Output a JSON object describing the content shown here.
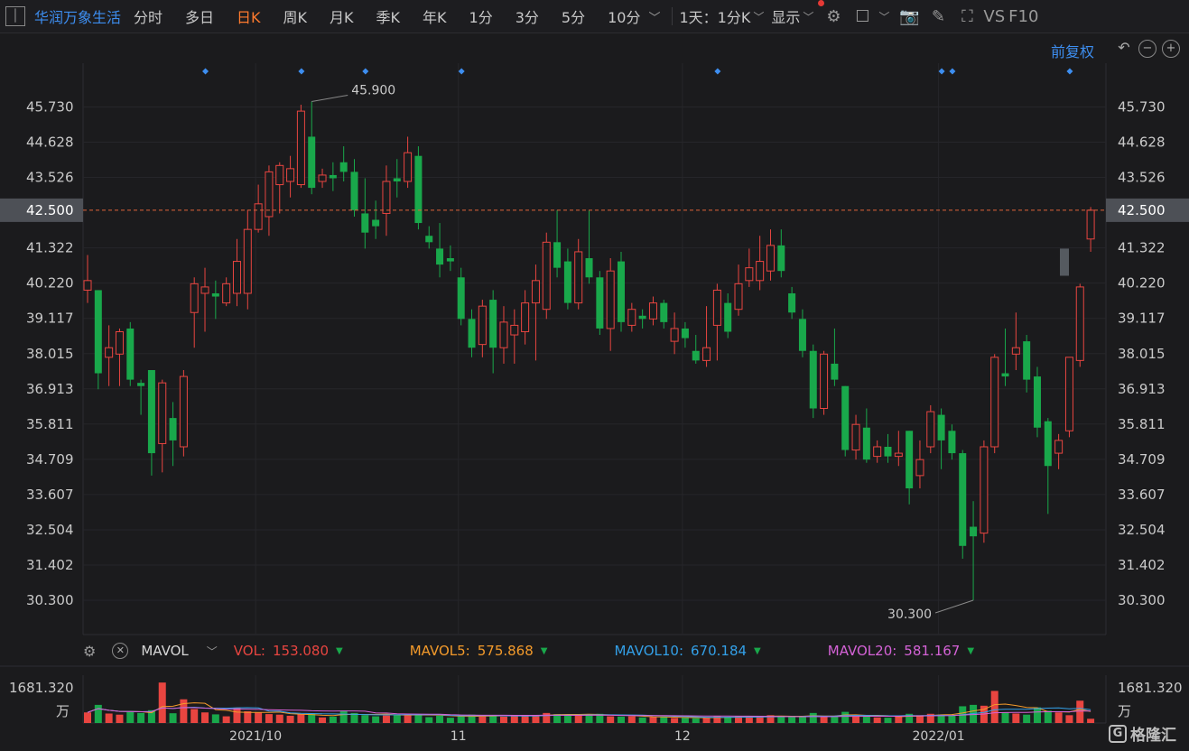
{
  "toolbar": {
    "stock_name": "华润万象生活",
    "periods": [
      "分时",
      "多日",
      "日K",
      "周K",
      "月K",
      "季K",
      "年K",
      "1分",
      "3分",
      "5分",
      "10分"
    ],
    "active_period": "日K",
    "multi_period": "1天：1分K",
    "display": "显示",
    "vs": "VS",
    "f10": "F10"
  },
  "adjust": {
    "label": "前复权"
  },
  "colors": {
    "up": "#e84540",
    "down": "#19a84b",
    "accent": "#3d8ef0",
    "active": "#ff7a2e",
    "mavol5": "#f39a2b",
    "mavol10": "#33a0e8",
    "mavol20": "#d462d6",
    "current_line": "#e0643a"
  },
  "price_axis": {
    "ticks": [
      "45.730",
      "44.628",
      "43.526",
      "41.322",
      "40.220",
      "39.117",
      "38.015",
      "36.913",
      "35.811",
      "34.709",
      "33.607",
      "32.504",
      "31.402",
      "30.300"
    ],
    "current": "42.500"
  },
  "annotations": {
    "high": "45.900",
    "low": "30.300"
  },
  "date_axis": [
    "2021/10",
    "11",
    "12",
    "2022/01"
  ],
  "volume_legend": {
    "indicator": "MAVOL",
    "vol_label": "VOL:",
    "vol_value": "153.080",
    "mavol5_label": "MAVOL5:",
    "mavol5_value": "575.868",
    "mavol10_label": "MAVOL10:",
    "mavol10_value": "670.184",
    "mavol20_label": "MAVOL20:",
    "mavol20_value": "581.167"
  },
  "volume_axis": {
    "max": "1681.320",
    "unit": "万"
  },
  "logo_text": "格隆汇",
  "chart_data": {
    "type": "candlestick",
    "ylim": [
      29.8,
      46.3
    ],
    "current_price": 42.5,
    "candles": [
      {
        "o": 40.0,
        "c": 40.3,
        "h": 41.1,
        "l": 39.6,
        "v": 380
      },
      {
        "o": 40.0,
        "c": 37.4,
        "h": 40.0,
        "l": 36.9,
        "v": 650
      },
      {
        "o": 37.9,
        "c": 38.2,
        "h": 38.9,
        "l": 37.0,
        "v": 340
      },
      {
        "o": 38.0,
        "c": 38.7,
        "h": 38.8,
        "l": 37.0,
        "v": 300
      },
      {
        "o": 38.8,
        "c": 37.2,
        "h": 39.0,
        "l": 37.0,
        "v": 390
      },
      {
        "o": 37.1,
        "c": 37.0,
        "h": 37.2,
        "l": 36.1,
        "v": 360
      },
      {
        "o": 37.5,
        "c": 34.9,
        "h": 37.5,
        "l": 34.2,
        "v": 460
      },
      {
        "o": 35.2,
        "c": 37.1,
        "h": 37.2,
        "l": 34.3,
        "v": 1450
      },
      {
        "o": 36.0,
        "c": 35.3,
        "h": 36.5,
        "l": 34.5,
        "v": 350
      },
      {
        "o": 35.1,
        "c": 37.3,
        "h": 37.5,
        "l": 34.8,
        "v": 850
      },
      {
        "o": 39.3,
        "c": 40.2,
        "h": 40.4,
        "l": 38.2,
        "v": 500
      },
      {
        "o": 39.9,
        "c": 40.1,
        "h": 40.7,
        "l": 38.7,
        "v": 380
      },
      {
        "o": 39.9,
        "c": 39.8,
        "h": 40.3,
        "l": 39.1,
        "v": 310
      },
      {
        "o": 39.6,
        "c": 40.2,
        "h": 40.4,
        "l": 39.5,
        "v": 240
      },
      {
        "o": 39.9,
        "c": 40.9,
        "h": 41.6,
        "l": 39.5,
        "v": 540
      },
      {
        "o": 39.9,
        "c": 41.9,
        "h": 42.5,
        "l": 39.4,
        "v": 420
      },
      {
        "o": 41.9,
        "c": 42.7,
        "h": 43.3,
        "l": 41.8,
        "v": 380
      },
      {
        "o": 42.3,
        "c": 43.7,
        "h": 43.9,
        "l": 41.7,
        "v": 320
      },
      {
        "o": 43.3,
        "c": 43.9,
        "h": 44.0,
        "l": 42.4,
        "v": 300
      },
      {
        "o": 43.4,
        "c": 43.8,
        "h": 44.2,
        "l": 42.9,
        "v": 260
      },
      {
        "o": 43.3,
        "c": 45.6,
        "h": 45.8,
        "l": 43.2,
        "v": 310
      },
      {
        "o": 44.8,
        "c": 43.2,
        "h": 45.9,
        "l": 43.0,
        "v": 330
      },
      {
        "o": 43.4,
        "c": 43.6,
        "h": 43.8,
        "l": 43.2,
        "v": 200
      },
      {
        "o": 43.6,
        "c": 43.5,
        "h": 44.0,
        "l": 43.1,
        "v": 230
      },
      {
        "o": 44.0,
        "c": 43.7,
        "h": 44.5,
        "l": 43.4,
        "v": 440
      },
      {
        "o": 43.7,
        "c": 42.5,
        "h": 44.1,
        "l": 42.3,
        "v": 360
      },
      {
        "o": 42.4,
        "c": 41.8,
        "h": 43.5,
        "l": 41.3,
        "v": 280
      },
      {
        "o": 42.2,
        "c": 42.0,
        "h": 42.8,
        "l": 41.6,
        "v": 240
      },
      {
        "o": 42.4,
        "c": 43.4,
        "h": 43.9,
        "l": 41.7,
        "v": 270
      },
      {
        "o": 43.5,
        "c": 43.4,
        "h": 44.1,
        "l": 42.9,
        "v": 300
      },
      {
        "o": 43.4,
        "c": 44.3,
        "h": 44.8,
        "l": 43.2,
        "v": 330
      },
      {
        "o": 44.2,
        "c": 42.1,
        "h": 44.5,
        "l": 41.9,
        "v": 320
      },
      {
        "o": 41.7,
        "c": 41.5,
        "h": 42.0,
        "l": 41.3,
        "v": 210
      },
      {
        "o": 41.3,
        "c": 40.8,
        "h": 42.1,
        "l": 40.4,
        "v": 260
      },
      {
        "o": 41.0,
        "c": 40.9,
        "h": 41.4,
        "l": 40.6,
        "v": 190
      },
      {
        "o": 40.4,
        "c": 39.1,
        "h": 40.7,
        "l": 38.9,
        "v": 240
      },
      {
        "o": 39.1,
        "c": 38.2,
        "h": 39.4,
        "l": 37.9,
        "v": 300
      },
      {
        "o": 38.3,
        "c": 39.5,
        "h": 39.7,
        "l": 37.9,
        "v": 240
      },
      {
        "o": 39.7,
        "c": 38.2,
        "h": 40.0,
        "l": 37.4,
        "v": 280
      },
      {
        "o": 38.2,
        "c": 39.0,
        "h": 39.5,
        "l": 37.7,
        "v": 230
      },
      {
        "o": 38.6,
        "c": 38.9,
        "h": 39.4,
        "l": 37.7,
        "v": 260
      },
      {
        "o": 38.7,
        "c": 39.6,
        "h": 40.0,
        "l": 38.3,
        "v": 280
      },
      {
        "o": 39.6,
        "c": 40.3,
        "h": 40.8,
        "l": 37.8,
        "v": 270
      },
      {
        "o": 39.4,
        "c": 41.5,
        "h": 41.8,
        "l": 39.1,
        "v": 360
      },
      {
        "o": 41.5,
        "c": 40.7,
        "h": 42.5,
        "l": 40.4,
        "v": 320
      },
      {
        "o": 40.9,
        "c": 39.6,
        "h": 41.3,
        "l": 39.4,
        "v": 300
      },
      {
        "o": 39.6,
        "c": 41.2,
        "h": 41.6,
        "l": 39.4,
        "v": 290
      },
      {
        "o": 41.0,
        "c": 40.4,
        "h": 42.5,
        "l": 40.2,
        "v": 300
      },
      {
        "o": 40.4,
        "c": 38.8,
        "h": 40.6,
        "l": 38.6,
        "v": 330
      },
      {
        "o": 38.8,
        "c": 40.6,
        "h": 41.0,
        "l": 38.1,
        "v": 240
      },
      {
        "o": 40.9,
        "c": 39.0,
        "h": 41.2,
        "l": 38.7,
        "v": 230
      },
      {
        "o": 38.9,
        "c": 39.4,
        "h": 39.6,
        "l": 38.7,
        "v": 240
      },
      {
        "o": 39.2,
        "c": 39.1,
        "h": 39.4,
        "l": 38.8,
        "v": 200
      },
      {
        "o": 39.1,
        "c": 39.6,
        "h": 39.8,
        "l": 38.9,
        "v": 210
      },
      {
        "o": 39.6,
        "c": 39.0,
        "h": 39.7,
        "l": 38.8,
        "v": 220
      },
      {
        "o": 38.4,
        "c": 38.8,
        "h": 39.3,
        "l": 38.0,
        "v": 180
      },
      {
        "o": 38.8,
        "c": 38.5,
        "h": 39.0,
        "l": 38.2,
        "v": 190
      },
      {
        "o": 38.1,
        "c": 37.8,
        "h": 38.6,
        "l": 37.7,
        "v": 170
      },
      {
        "o": 37.8,
        "c": 38.2,
        "h": 39.5,
        "l": 37.6,
        "v": 190
      },
      {
        "o": 38.9,
        "c": 40.0,
        "h": 40.2,
        "l": 37.8,
        "v": 250
      },
      {
        "o": 39.6,
        "c": 38.7,
        "h": 39.9,
        "l": 38.5,
        "v": 220
      },
      {
        "o": 39.4,
        "c": 40.2,
        "h": 40.8,
        "l": 39.2,
        "v": 240
      },
      {
        "o": 40.3,
        "c": 40.7,
        "h": 41.3,
        "l": 40.1,
        "v": 230
      },
      {
        "o": 40.3,
        "c": 40.9,
        "h": 41.7,
        "l": 40.0,
        "v": 260
      },
      {
        "o": 40.6,
        "c": 41.4,
        "h": 41.9,
        "l": 40.3,
        "v": 280
      },
      {
        "o": 41.4,
        "c": 40.6,
        "h": 41.9,
        "l": 40.4,
        "v": 240
      },
      {
        "o": 39.9,
        "c": 39.3,
        "h": 40.1,
        "l": 39.1,
        "v": 210
      },
      {
        "o": 39.1,
        "c": 38.1,
        "h": 39.4,
        "l": 37.9,
        "v": 230
      },
      {
        "o": 38.1,
        "c": 36.3,
        "h": 38.3,
        "l": 36.0,
        "v": 360
      },
      {
        "o": 36.3,
        "c": 38.0,
        "h": 38.1,
        "l": 36.1,
        "v": 210
      },
      {
        "o": 37.7,
        "c": 37.2,
        "h": 38.8,
        "l": 37.0,
        "v": 250
      },
      {
        "o": 37.0,
        "c": 35.0,
        "h": 37.0,
        "l": 34.8,
        "v": 400
      },
      {
        "o": 35.0,
        "c": 35.8,
        "h": 36.1,
        "l": 34.7,
        "v": 250
      },
      {
        "o": 35.7,
        "c": 34.7,
        "h": 36.3,
        "l": 34.6,
        "v": 270
      },
      {
        "o": 34.8,
        "c": 35.1,
        "h": 35.3,
        "l": 34.6,
        "v": 200
      },
      {
        "o": 35.1,
        "c": 34.8,
        "h": 35.5,
        "l": 34.6,
        "v": 190
      },
      {
        "o": 34.8,
        "c": 34.9,
        "h": 35.6,
        "l": 34.5,
        "v": 230
      },
      {
        "o": 35.6,
        "c": 33.8,
        "h": 35.6,
        "l": 33.3,
        "v": 330
      },
      {
        "o": 34.2,
        "c": 34.7,
        "h": 35.3,
        "l": 33.8,
        "v": 280
      },
      {
        "o": 35.1,
        "c": 36.2,
        "h": 36.4,
        "l": 34.9,
        "v": 330
      },
      {
        "o": 36.1,
        "c": 35.3,
        "h": 36.3,
        "l": 34.4,
        "v": 300
      },
      {
        "o": 35.6,
        "c": 34.9,
        "h": 35.8,
        "l": 34.7,
        "v": 280
      },
      {
        "o": 34.9,
        "c": 32.0,
        "h": 35.0,
        "l": 31.6,
        "v": 600
      },
      {
        "o": 32.6,
        "c": 32.3,
        "h": 33.4,
        "l": 30.3,
        "v": 650
      },
      {
        "o": 32.4,
        "c": 35.1,
        "h": 35.3,
        "l": 32.1,
        "v": 620
      },
      {
        "o": 35.1,
        "c": 37.9,
        "h": 38.0,
        "l": 34.9,
        "v": 1150
      },
      {
        "o": 37.4,
        "c": 37.3,
        "h": 38.8,
        "l": 37.0,
        "v": 380
      },
      {
        "o": 38.0,
        "c": 38.2,
        "h": 39.3,
        "l": 37.5,
        "v": 340
      },
      {
        "o": 38.4,
        "c": 37.2,
        "h": 38.6,
        "l": 36.8,
        "v": 300
      },
      {
        "o": 37.3,
        "c": 35.7,
        "h": 37.6,
        "l": 35.4,
        "v": 560
      },
      {
        "o": 35.9,
        "c": 34.5,
        "h": 36.0,
        "l": 33.0,
        "v": 440
      },
      {
        "o": 34.9,
        "c": 35.3,
        "h": 35.5,
        "l": 34.4,
        "v": 380
      },
      {
        "o": 35.6,
        "c": 37.9,
        "h": 37.9,
        "l": 35.4,
        "v": 280
      },
      {
        "o": 37.8,
        "c": 40.1,
        "h": 40.2,
        "l": 37.6,
        "v": 800
      },
      {
        "o": 41.6,
        "c": 42.5,
        "h": 42.6,
        "l": 41.2,
        "v": 153
      }
    ],
    "event_marker_indices": [
      11,
      20,
      26,
      35,
      59,
      80,
      81,
      92
    ],
    "date_marks": [
      {
        "label": "2021/10",
        "index": 16
      },
      {
        "label": "11",
        "index": 35
      },
      {
        "label": "12",
        "index": 56
      },
      {
        "label": "2022/01",
        "index": 80
      }
    ],
    "y_ticks": [
      45.73,
      44.628,
      43.526,
      41.322,
      40.22,
      39.117,
      38.015,
      36.913,
      35.811,
      34.709,
      33.607,
      32.504,
      31.402,
      30.3
    ],
    "volume_max": 1681.32,
    "high_index": 21,
    "low_index": 83
  }
}
